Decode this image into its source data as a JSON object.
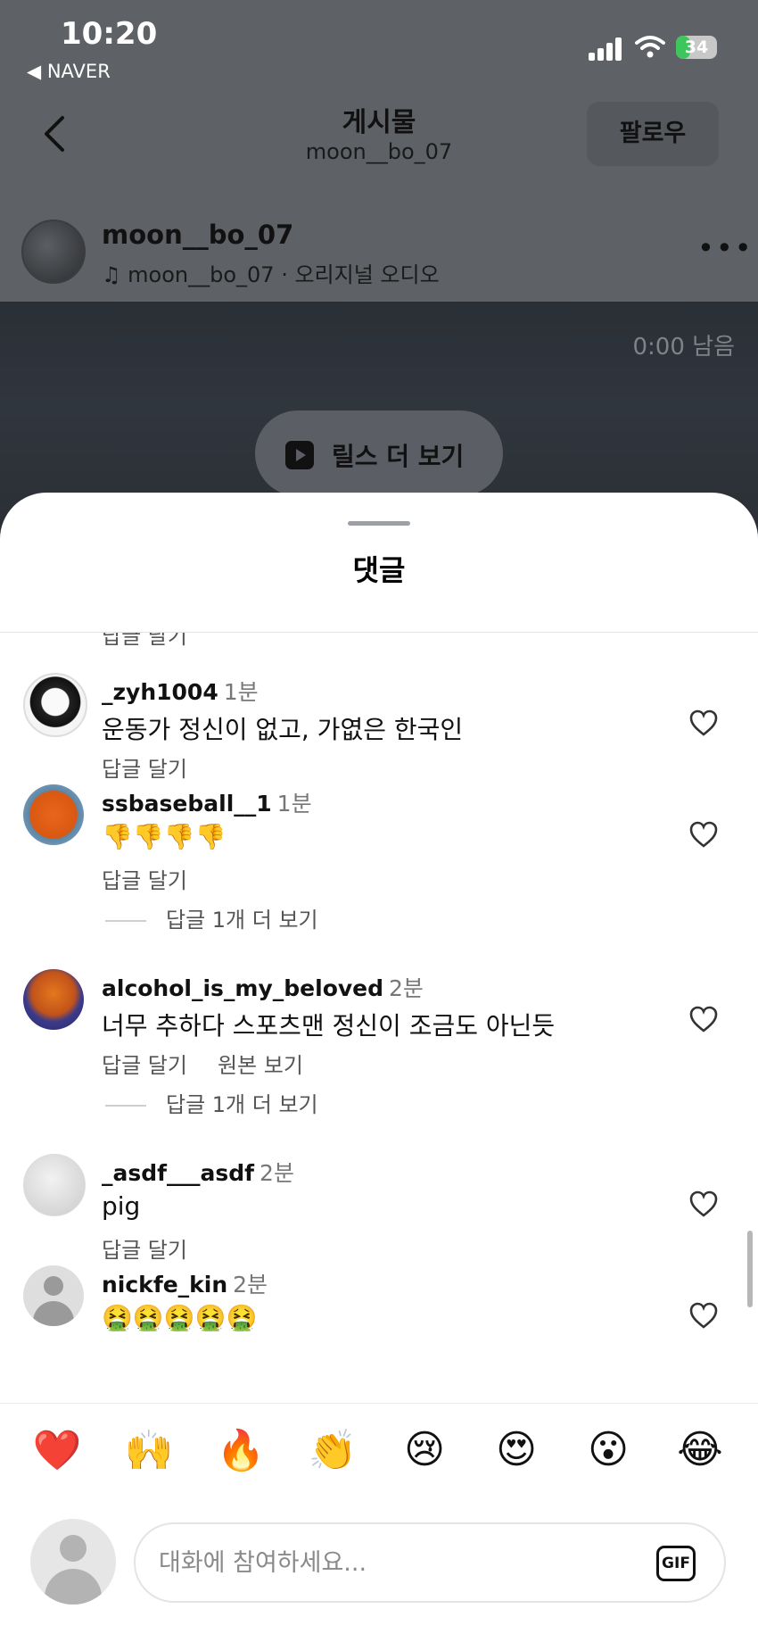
{
  "status_bar": {
    "time": "10:20",
    "back_app": "◀ NAVER",
    "battery": "34"
  },
  "header": {
    "title": "게시물",
    "subtitle": "moon__bo_07",
    "follow_label": "팔로우"
  },
  "post": {
    "author": "moon__bo_07",
    "audio": "moon__bo_07 · 오리지널 오디오",
    "more": "•••"
  },
  "video": {
    "time_left": "0:00 남음",
    "reels_label": "릴스 더 보기"
  },
  "comments_sheet": {
    "title": "댓글",
    "partial_reply": "답글 달기",
    "comments": [
      {
        "user": "_zyh1004",
        "time": "1분",
        "text": "운동가 정신이 없고, 가엾은 한국인",
        "actions": [
          "답글 달기"
        ],
        "more_replies": ""
      },
      {
        "user": "ssbaseball__1",
        "time": "1분",
        "text": "👎👎👎👎",
        "actions": [
          "답글 달기"
        ],
        "more_replies": "답글 1개 더 보기"
      },
      {
        "user": "alcohol_is_my_beloved",
        "time": "2분",
        "text": "너무 추하다 스포츠맨 정신이 조금도 아닌듯",
        "actions": [
          "답글 달기",
          "원본 보기"
        ],
        "more_replies": "답글 1개 더 보기"
      },
      {
        "user": "_asdf___asdf",
        "time": "2분",
        "text": "pig",
        "actions": [
          "답글 달기"
        ],
        "more_replies": ""
      },
      {
        "user": "nickfe_kin",
        "time": "2분",
        "text": "🤮🤮🤮🤮🤮",
        "actions": [],
        "more_replies": ""
      }
    ],
    "reactions": [
      "❤️",
      "🙌",
      "🔥",
      "👏",
      "😢",
      "😍",
      "😮",
      "😂"
    ],
    "input_placeholder": "대화에 참여하세요...",
    "gif_label": "GIF"
  },
  "colors": {
    "overlay": "#5e6165",
    "sheet": "#ffffff",
    "battery_fill": "#3ec55b"
  }
}
